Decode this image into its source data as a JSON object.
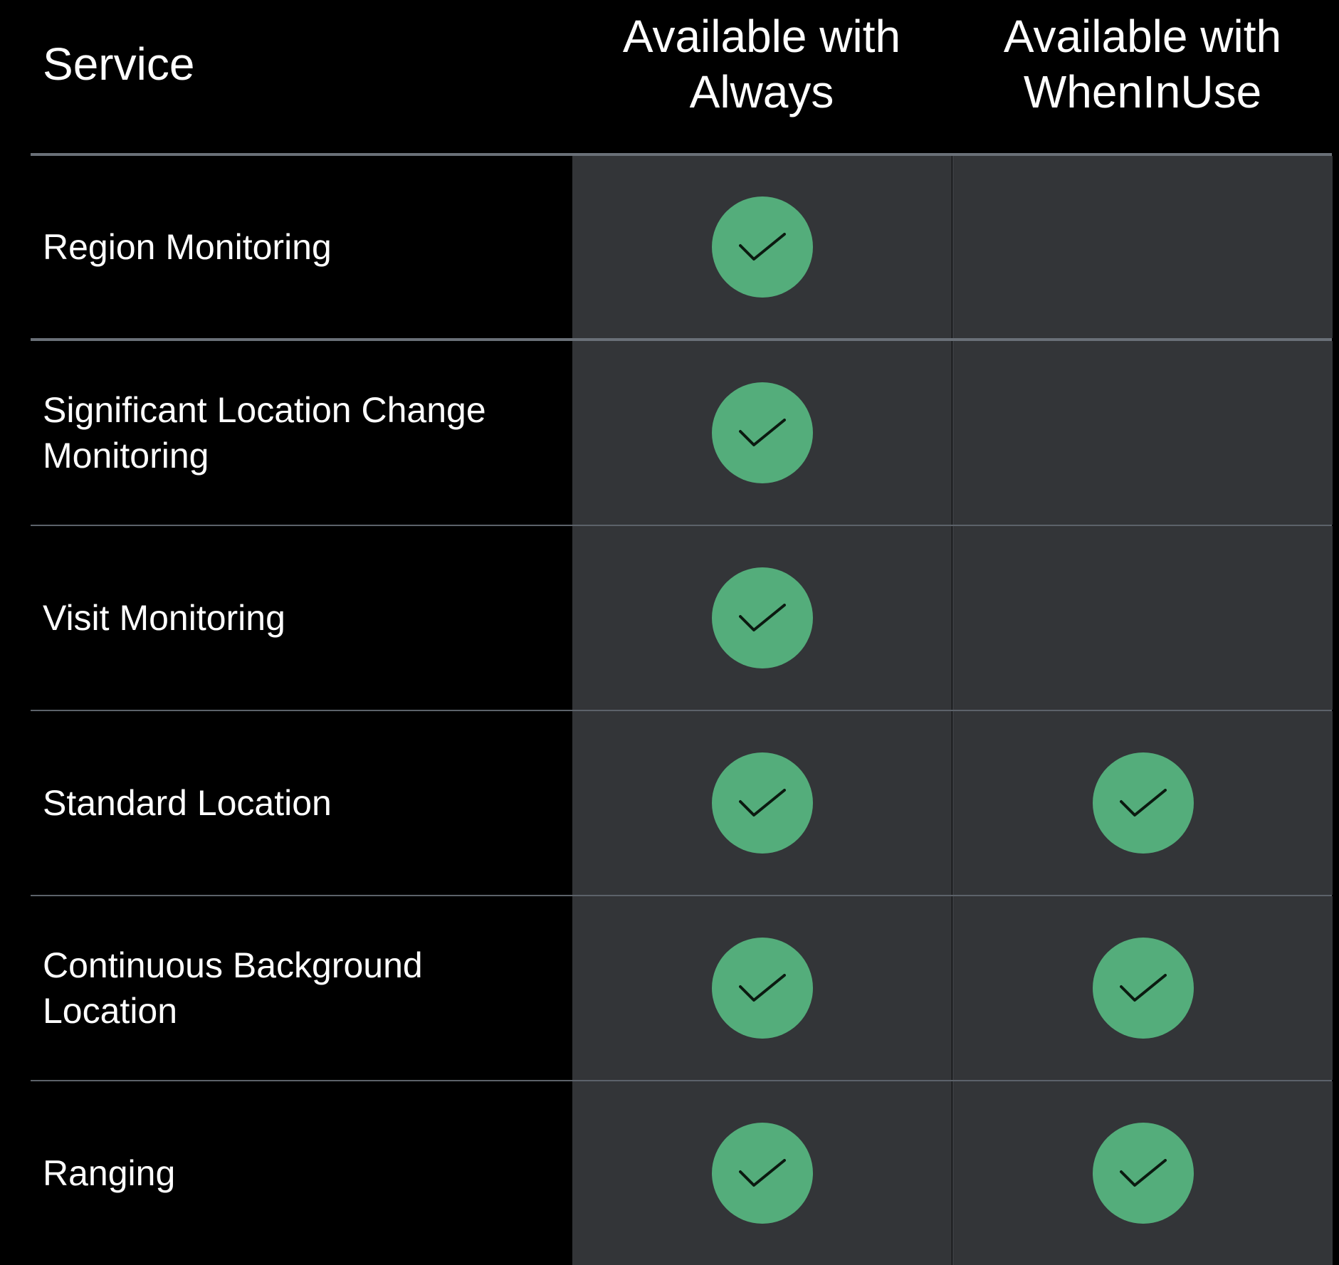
{
  "header": {
    "service_label": "Service",
    "col_always": [
      "Available with",
      "Always"
    ],
    "col_wheninuse": [
      "Available with",
      "WhenInUse"
    ]
  },
  "rows": [
    {
      "label": "Region Monitoring",
      "always": true,
      "wheninuse": false
    },
    {
      "label": "Significant Location Change Monitoring",
      "always": true,
      "wheninuse": false
    },
    {
      "label": "Visit Monitoring",
      "always": true,
      "wheninuse": false
    },
    {
      "label": "Standard Location",
      "always": true,
      "wheninuse": true
    },
    {
      "label": "Continuous Background Location",
      "always": true,
      "wheninuse": true
    },
    {
      "label": "Ranging",
      "always": true,
      "wheninuse": true
    }
  ],
  "icons": {
    "available": "checkmark-icon"
  },
  "colors": {
    "background": "#000000",
    "cell": "#333538",
    "check": "#54ad7b",
    "rule": "#6a7078"
  }
}
